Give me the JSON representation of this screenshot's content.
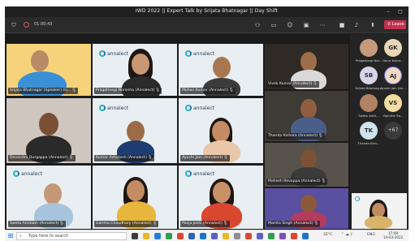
{
  "window": {
    "title": "IWD 2022 || Expert Talk by Srijata Bhatnagar || Day Shift",
    "minimize": "–",
    "maximize": "◻"
  },
  "toolbar": {
    "timer": "01:00:43",
    "leave_label": "Leave"
  },
  "tiles": [
    {
      "name": "Srijata Bhatnagar (Speaker) (G...",
      "bg": "#f6d37a"
    },
    {
      "name": "Pragatinegi Noronha (Annalect)",
      "bg": "#e8eef3"
    },
    {
      "name": "Mohan Kumar (Annalect)",
      "bg": "#eef2f5"
    },
    {
      "name": "Vivek Kumar (Annalect)",
      "bg": "#2f2a26"
    },
    {
      "name": "Devendra Durgappa (Annalect)",
      "bg": "#cfc7bf"
    },
    {
      "name": "Kumar Ashutosh (Annalect)",
      "bg": "#e9eef2"
    },
    {
      "name": "Ayushi Jain (Annalect)",
      "bg": "#e9eef2"
    },
    {
      "name": "Thanda Kishore (Annalect)",
      "bg": "#3e3a35"
    },
    {
      "name": "Mahesh Revappa (Annalect)",
      "bg": "#57524c"
    },
    {
      "name": "Sweta Amitabh (Annalect)",
      "bg": "#eef2f5"
    },
    {
      "name": "Garima Chaudhary (Annalect)",
      "bg": "#eef2f5"
    },
    {
      "name": "Pooja Joshi (Annalect)",
      "bg": "#eef2f5"
    },
    {
      "name": "Mamta Singh (Annalect)",
      "bg": "#5a4fa0"
    },
    {
      "name": "",
      "bg": "#f2f2f2"
    }
  ],
  "brand": {
    "logo_text": "annalect"
  },
  "side_panel": {
    "avatars": [
      {
        "initials": "",
        "label": "Pragatinegi Nor...",
        "color": "#c49a7a"
      },
      {
        "initials": "GK",
        "label": "Gauri Kukut...",
        "color": "#e8d6b8"
      },
      {
        "initials": "SB",
        "label": "Srijata Bhatnag...",
        "color": "#d9d3ea"
      },
      {
        "initials": "AJ",
        "label": "Ayushi Jain (An...",
        "color": "#f0d9c6"
      },
      {
        "initials": "",
        "label": "Sweta Amit...",
        "color": "#b28363"
      },
      {
        "initials": "VS",
        "label": "Vipinder Sa...",
        "color": "#f3dca0"
      },
      {
        "initials": "TK",
        "label": "Thanda Kish...",
        "color": "#cfe3ef"
      },
      {
        "initials": "+67",
        "label": "",
        "color": "#3a3a3a"
      }
    ]
  },
  "taskbar": {
    "search_placeholder": "Type here to search",
    "temperature": "32°C",
    "lang": "ENG",
    "time": "17:09",
    "date": "14-03-2022"
  }
}
